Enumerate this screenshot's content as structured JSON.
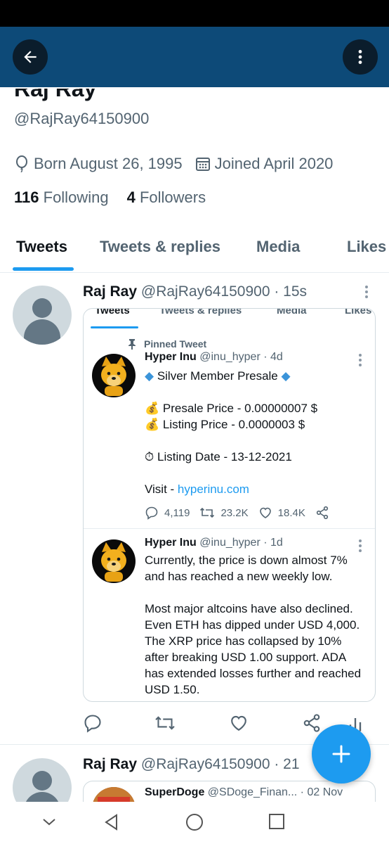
{
  "appbar": {
    "back_icon": "arrow-left-icon",
    "more_icon": "more-vertical-icon",
    "color": "#0d4a78"
  },
  "profile": {
    "name": "Raj Ray",
    "handle": "@RajRay64150900",
    "born": "Born August 26, 1995",
    "joined": "Joined April 2020",
    "following_count": "116",
    "following_label": "Following",
    "followers_count": "4",
    "followers_label": "Followers"
  },
  "tabs": [
    {
      "label": "Tweets",
      "active": true
    },
    {
      "label": "Tweets & replies"
    },
    {
      "label": "Media"
    },
    {
      "label": "Likes"
    }
  ],
  "tweet1": {
    "name": "Raj Ray",
    "handle": "@RajRay64150900",
    "time": "· 15s",
    "card": {
      "inner_tabs": [
        "Tweets",
        "Tweets & replies",
        "Media",
        "Likes"
      ],
      "pinned_label": "Pinned Tweet",
      "post1": {
        "name": "Hyper Inu",
        "handle": "@inu_hyper · 4d",
        "line1": "Silver Member Presale",
        "line2": "Presale Price - 0.00000007 $",
        "line3": "Listing Price - 0.0000003 $",
        "line4": "Listing Date - 13-12-2021",
        "visit_prefix": "Visit - ",
        "visit_link": "hyperinu.com",
        "replies": "4,119",
        "retweets": "23.2K",
        "likes": "18.4K"
      },
      "post2": {
        "name": "Hyper Inu",
        "handle": "@inu_hyper · 1d",
        "para1_l1": "Currently, the price is down almost 7%",
        "para1_l2": "and has reached a new weekly low.",
        "para2_l1": "Most major altcoins have also declined.",
        "para2_l2": "Even ETH has dipped under USD 4,000.",
        "para2_l3": "The XRP price has collapsed by 10%",
        "para2_l4": "after breaking USD 1.00 support. ADA",
        "para2_l5": "has extended losses further and reached",
        "para2_l6": "USD 1.50."
      }
    }
  },
  "tweet2": {
    "name": "Raj Ray",
    "handle": "@RajRay64150900",
    "time": "· 21",
    "card": {
      "name": "SuperDoge",
      "handle": "@SDoge_Finan...",
      "time": "· 02 Nov"
    }
  },
  "fab": {
    "icon": "plus-icon",
    "color": "#1d9bf0"
  },
  "navbar": {
    "icons": [
      "chevron-down-icon",
      "back-triangle-icon",
      "home-circle-icon",
      "recents-square-icon"
    ]
  }
}
